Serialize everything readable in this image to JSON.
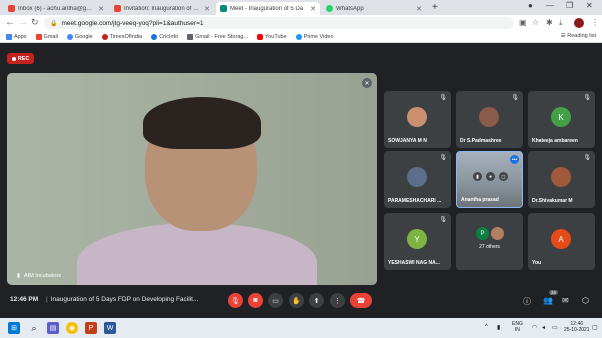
{
  "tabs": [
    {
      "title": "Inbox (6) - achu.antha@gmail.co",
      "icon": "gmail-icon",
      "color": "#ea4335"
    },
    {
      "title": "Invitation: Inauguration of 5 Days",
      "icon": "gmail-icon",
      "color": "#ea4335"
    },
    {
      "title": "Meet - Inauguration of 5 Da",
      "icon": "meet-icon",
      "color": "#00897b"
    },
    {
      "title": "WhatsApp",
      "icon": "whatsapp-icon",
      "color": "#25d366"
    }
  ],
  "address_bar": {
    "url": "meet.google.com/jtg-veeq-yoq?pli=1&authuser=1"
  },
  "bookmarks": [
    {
      "label": "Apps",
      "color": "#4285f4"
    },
    {
      "label": "Gmail",
      "color": "#ea4335"
    },
    {
      "label": "Google",
      "color": "#4285f4"
    },
    {
      "label": "TimesOfIndia",
      "color": "#c5221f"
    },
    {
      "label": "CricInfo",
      "color": "#1a73e8"
    },
    {
      "label": "Gmail - Free Storag...",
      "color": "#5f6368"
    },
    {
      "label": "YouTube",
      "color": "#ff0000"
    },
    {
      "label": "Prime Video",
      "color": "#1a98ff"
    }
  ],
  "reading_list": "Reading list",
  "meet": {
    "rec_label": "REC",
    "main_speaker": "AIM Incubators",
    "participants": [
      {
        "name": "SOWJANYA M N",
        "initial": "",
        "color": "#c98f6e"
      },
      {
        "name": "Dr S.Padmashree",
        "initial": "",
        "color": "#8a5a4a"
      },
      {
        "name": "Khateeja ambareen",
        "initial": "K",
        "color": "#43a047"
      },
      {
        "name": "PARAMESHACHARI ...",
        "initial": "",
        "color": "#5b6f8a"
      },
      {
        "name": "Anantha prasad",
        "initial": "",
        "color": "#8a9195"
      },
      {
        "name": "Dr.Shivakumar M",
        "initial": "",
        "color": "#a05a3a"
      },
      {
        "name": "YESHASWI NAG NA...",
        "initial": "Y",
        "color": "#7cb342"
      },
      {
        "name": "27 others",
        "initial": "P",
        "color": "#0b8043"
      },
      {
        "name": "You",
        "initial": "A",
        "color": "#e64a19"
      }
    ],
    "clock": "12:46 PM",
    "meeting_title": "Inauguration of 5 Days FDP on Developing Facilit...",
    "people_count": "36"
  },
  "taskbar": {
    "lang_top": "ENG",
    "lang_bottom": "IN",
    "time": "12:46",
    "date": "25-10-2021"
  }
}
